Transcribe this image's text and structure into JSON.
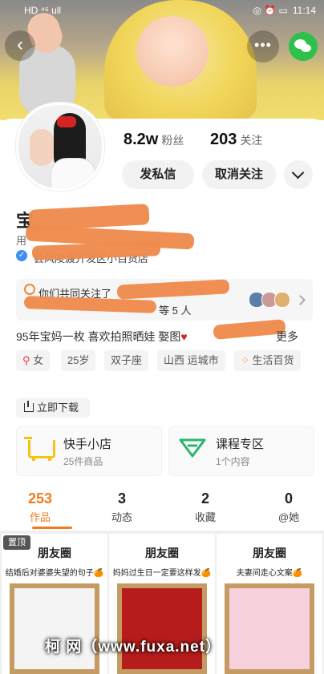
{
  "status_bar": {
    "time": "11:14",
    "left_icons": "HD ⁴⁶ ull",
    "right_icons": "◎ ⏰ ▭"
  },
  "header": {
    "back_icon": "‹",
    "more_icon": "•••"
  },
  "stats": {
    "fans_value": "8.2w",
    "fans_label": "粉丝",
    "following_value": "203",
    "following_label": "关注"
  },
  "actions": {
    "message": "发私信",
    "unfollow": "取消关注"
  },
  "profile": {
    "name": "宝",
    "line1_prefix": "用",
    "shop_location": "县风陵渡开发区小百货店",
    "common_follow": "你们共同关注了",
    "common_follow_tail": "等 5 人",
    "bio": "95年宝妈一枚 喜欢拍照晒娃 娶图",
    "bio_more": "更多"
  },
  "tags": [
    "女",
    "25岁",
    "双子座",
    "山西 运城市",
    "生活百货"
  ],
  "download": "立即下载",
  "services": [
    {
      "title": "快手小店",
      "sub": "25件商品"
    },
    {
      "title": "课程专区",
      "sub": "1个内容"
    }
  ],
  "tabs": [
    {
      "count": "253",
      "label": "作品"
    },
    {
      "count": "3",
      "label": "动态"
    },
    {
      "count": "2",
      "label": "收藏"
    },
    {
      "count": "0",
      "label": "@她"
    }
  ],
  "pinned": "置顶",
  "posts": [
    {
      "title": "朋友圈",
      "subtitle": "结婚后对婆婆失望的句子🍊"
    },
    {
      "title": "朋友圈",
      "subtitle": "妈妈过生日一定要这样发🍊"
    },
    {
      "title": "朋友圈",
      "subtitle": "夫妻间走心文案🍊"
    }
  ],
  "watermark": "柯   网（www.fuxa.net）",
  "colors": {
    "accent": "#f07c1d",
    "wechat": "#2dc14b",
    "redaction": "#ee8a4c"
  }
}
